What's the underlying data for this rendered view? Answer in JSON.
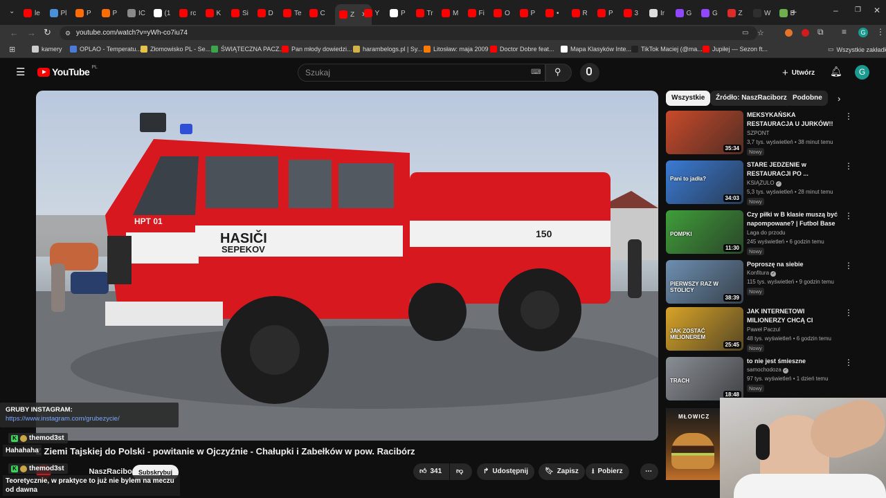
{
  "browser": {
    "tabs": [
      {
        "label": "le",
        "color": "#ff0000"
      },
      {
        "label": "Pl",
        "color": "#4a90d9"
      },
      {
        "label": "P",
        "color": "#ff6d00"
      },
      {
        "label": "P",
        "color": "#ff6d00"
      },
      {
        "label": "IC",
        "color": "#8a8a8a"
      },
      {
        "label": "(1",
        "color": "#ffffff"
      },
      {
        "label": "rc",
        "color": "#ff0000"
      },
      {
        "label": "K",
        "color": "#ff0000"
      },
      {
        "label": "Si",
        "color": "#ff0000"
      },
      {
        "label": "D",
        "color": "#ff0000"
      },
      {
        "label": "Te",
        "color": "#ff0000"
      },
      {
        "label": "C",
        "color": "#ff0000"
      },
      {
        "label": "Z",
        "color": "#ff0000"
      },
      {
        "label": "Y",
        "color": "#ff0000"
      },
      {
        "label": "P",
        "color": "#ffffff"
      },
      {
        "label": "Tr",
        "color": "#ff0000"
      },
      {
        "label": "M",
        "color": "#ff0000"
      },
      {
        "label": "Fi",
        "color": "#ff0000"
      },
      {
        "label": "O",
        "color": "#ff0000"
      },
      {
        "label": "P",
        "color": "#ff0000"
      },
      {
        "label": "•",
        "color": "#ff0000"
      },
      {
        "label": "R",
        "color": "#ff0000"
      },
      {
        "label": "P",
        "color": "#ff0000"
      },
      {
        "label": "3",
        "color": "#ff0000"
      },
      {
        "label": "Ir",
        "color": "#dddddd"
      },
      {
        "label": "G",
        "color": "#9146ff"
      },
      {
        "label": "G",
        "color": "#9146ff"
      },
      {
        "label": "Z",
        "color": "#e02a2a"
      },
      {
        "label": "W",
        "color": "#2f2f2f"
      },
      {
        "label": "B",
        "color": "#6fae4c"
      }
    ],
    "url": "youtube.com/watch?v=yWh-co7iu74",
    "bookmarks": [
      {
        "label": "kamery",
        "color": "#cccccc"
      },
      {
        "label": "OPLAO - Temperatu...",
        "color": "#4a7bd9"
      },
      {
        "label": "Złomowisko PL - Se...",
        "color": "#e6c24a"
      },
      {
        "label": "ŚWIĄTECZNA PACZ...",
        "color": "#3ca54a"
      },
      {
        "label": "Pan młody dowiedzi...",
        "color": "#ff0000"
      },
      {
        "label": "harambelogs.pl | Sy...",
        "color": "#d4b24a"
      },
      {
        "label": "Litosław: maja 2009",
        "color": "#ff7a00"
      },
      {
        "label": "Doctor Dobre feat...",
        "color": "#ff0000"
      },
      {
        "label": "Mapa Klasyków Inte...",
        "color": "#ffffff"
      },
      {
        "label": "TikTok Maciej (@ma...",
        "color": "#222222"
      },
      {
        "label": "Jupiłej — Sezon ft...",
        "color": "#ff0000"
      }
    ],
    "all_bookmarks": "Wszystkie zakładki"
  },
  "youtube": {
    "logo": "YouTube",
    "region": "PL",
    "search_placeholder": "Szukaj",
    "create_label": "Utwórz",
    "avatar_letter": "G"
  },
  "video": {
    "title": "Z Ziemi Tajskiej do Polski - powitanie w Ojczyźnie - Chałupki i Zabełków w pow. Racibórz",
    "truck_text_1": "HASIČI",
    "truck_text_2": "SEPEKOV",
    "truck_plate": "HPT 01",
    "truck_number": "150",
    "channel": "NaszRaciborz",
    "subscribe_label": "Subskrybuj",
    "like_count": "341",
    "share_label": "Udostępnij",
    "save_label": "Zapisz",
    "download_label": "Pobierz"
  },
  "sidebar": {
    "chips": [
      "Wszystkie",
      "Źródło: NaszRaciborz",
      "Podobne"
    ],
    "recommendations": [
      {
        "title": "MEKSYKAŃSKA RESTAURACJA U JURKÓW!! (ROZGOTOWANI!)",
        "channel": "SZPONT",
        "meta": "3,7 tys. wyświetleń • 38 minut temu",
        "duration": "35:34",
        "badge": "Nowy",
        "thumb_color": "#c94a2a",
        "verified": false
      },
      {
        "title": "STARE JEDZENIE w RESTAURACJI PO ...",
        "channel": "KSIĄŻULO",
        "meta": "5,3 tys. wyświetleń • 28 minut temu",
        "duration": "34:03",
        "badge": "Nowy",
        "thumb_color": "#3a7bd5",
        "verified": true,
        "thumb_text": "Pani to jadła?"
      },
      {
        "title": "Czy piłki w B klasie muszą być napompowane? | Futbol Base ...",
        "channel": "Laga do przodu",
        "meta": "245 wyświetleń • 6 godzin temu",
        "duration": "11:30",
        "badge": "Nowy",
        "thumb_color": "#3f9e3a",
        "verified": false,
        "thumb_text": "POMPKI"
      },
      {
        "title": "Poproszę na siebie",
        "channel": "Konfitura",
        "meta": "115 tys. wyświetleń • 9 godzin temu",
        "duration": "38:39",
        "badge": "Nowy",
        "thumb_color": "#6d8fb1",
        "verified": true,
        "thumb_text": "PIERWSZY RAZ W STOLICY"
      },
      {
        "title": "JAK INTERNETOWI MILIONERZY CHCĄ CI WYPRA...",
        "channel": "Paweł Paczul",
        "meta": "48 tys. wyświetleń • 6 godzin temu",
        "duration": "25:45",
        "badge": "Nowy",
        "thumb_color": "#d8a428",
        "verified": false,
        "thumb_text": "JAK ZOSTAĆ MILIONEREM"
      },
      {
        "title": "to nie jest śmieszne",
        "channel": "samochodoza",
        "meta": "97 tys. wyświetleń • 1 dzień temu",
        "duration": "18:48",
        "badge": "Nowy",
        "thumb_color": "#8a8f96",
        "verified": true,
        "thumb_text": "TRACH"
      }
    ]
  },
  "overlay": {
    "instagram_title": "GRUBY INSTAGRAM:",
    "instagram_url": "https://www.instagram.com/grubezycie/",
    "messages": [
      {
        "user": "themod3st",
        "text": "Hahahaha"
      },
      {
        "user": "themod3st",
        "text": "Teoretycznie, w praktyce to już nie bylem na meczu od dawna"
      }
    ],
    "promo_label": "MŁOWICZ"
  },
  "colors": {
    "youtube_red": "#ff0000",
    "truck_red": "#d7191f",
    "accent_link": "#3ea6ff"
  }
}
